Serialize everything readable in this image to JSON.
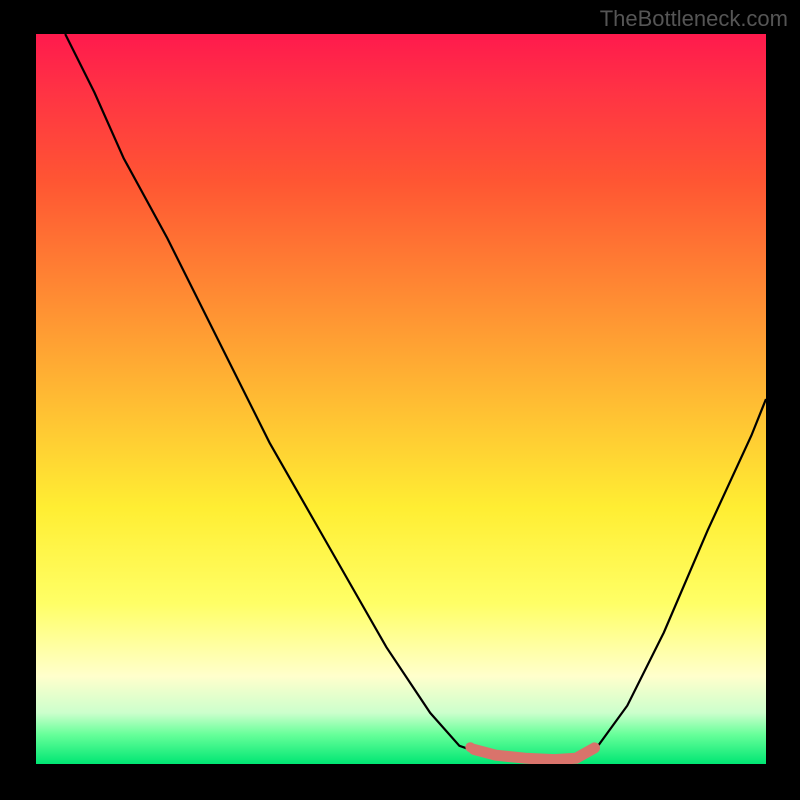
{
  "watermark": "TheBottleneck.com",
  "chart_data": {
    "type": "line",
    "title": "",
    "xlabel": "",
    "ylabel": "",
    "xlim": [
      0,
      100
    ],
    "ylim": [
      0,
      100
    ],
    "series": [
      {
        "name": "bottleneck-curve",
        "color": "#000000",
        "points": [
          {
            "x": 4,
            "y": 100
          },
          {
            "x": 8,
            "y": 92
          },
          {
            "x": 12,
            "y": 83
          },
          {
            "x": 18,
            "y": 72
          },
          {
            "x": 25,
            "y": 58
          },
          {
            "x": 32,
            "y": 44
          },
          {
            "x": 40,
            "y": 30
          },
          {
            "x": 48,
            "y": 16
          },
          {
            "x": 54,
            "y": 7
          },
          {
            "x": 58,
            "y": 2.5
          },
          {
            "x": 60,
            "y": 1.8
          },
          {
            "x": 63,
            "y": 1.2
          },
          {
            "x": 67,
            "y": 0.8
          },
          {
            "x": 71,
            "y": 0.6
          },
          {
            "x": 74,
            "y": 0.8
          },
          {
            "x": 77,
            "y": 2.5
          },
          {
            "x": 81,
            "y": 8
          },
          {
            "x": 86,
            "y": 18
          },
          {
            "x": 92,
            "y": 32
          },
          {
            "x": 98,
            "y": 45
          },
          {
            "x": 100,
            "y": 50
          }
        ]
      },
      {
        "name": "highlight-region",
        "color": "#d9736b",
        "points": [
          {
            "x": 60,
            "y": 2.0
          },
          {
            "x": 63,
            "y": 1.2
          },
          {
            "x": 67,
            "y": 0.8
          },
          {
            "x": 71,
            "y": 0.6
          },
          {
            "x": 74,
            "y": 0.8
          },
          {
            "x": 76.5,
            "y": 2.2
          }
        ]
      }
    ],
    "marker": {
      "x": 59.5,
      "y": 2.3,
      "color": "#d9736b",
      "radius": 5
    },
    "gradient_stops": [
      {
        "offset": 0,
        "color": "#ff1a4d"
      },
      {
        "offset": 50,
        "color": "#ffee33"
      },
      {
        "offset": 100,
        "color": "#00e673"
      }
    ]
  }
}
